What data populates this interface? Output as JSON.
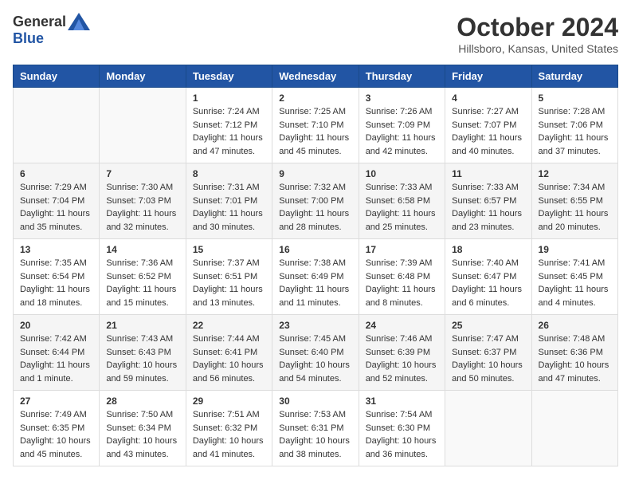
{
  "header": {
    "logo_general": "General",
    "logo_blue": "Blue",
    "month": "October 2024",
    "location": "Hillsboro, Kansas, United States"
  },
  "weekdays": [
    "Sunday",
    "Monday",
    "Tuesday",
    "Wednesday",
    "Thursday",
    "Friday",
    "Saturday"
  ],
  "weeks": [
    [
      {
        "day": "",
        "info": ""
      },
      {
        "day": "",
        "info": ""
      },
      {
        "day": "1",
        "info": "Sunrise: 7:24 AM\nSunset: 7:12 PM\nDaylight: 11 hours and 47 minutes."
      },
      {
        "day": "2",
        "info": "Sunrise: 7:25 AM\nSunset: 7:10 PM\nDaylight: 11 hours and 45 minutes."
      },
      {
        "day": "3",
        "info": "Sunrise: 7:26 AM\nSunset: 7:09 PM\nDaylight: 11 hours and 42 minutes."
      },
      {
        "day": "4",
        "info": "Sunrise: 7:27 AM\nSunset: 7:07 PM\nDaylight: 11 hours and 40 minutes."
      },
      {
        "day": "5",
        "info": "Sunrise: 7:28 AM\nSunset: 7:06 PM\nDaylight: 11 hours and 37 minutes."
      }
    ],
    [
      {
        "day": "6",
        "info": "Sunrise: 7:29 AM\nSunset: 7:04 PM\nDaylight: 11 hours and 35 minutes."
      },
      {
        "day": "7",
        "info": "Sunrise: 7:30 AM\nSunset: 7:03 PM\nDaylight: 11 hours and 32 minutes."
      },
      {
        "day": "8",
        "info": "Sunrise: 7:31 AM\nSunset: 7:01 PM\nDaylight: 11 hours and 30 minutes."
      },
      {
        "day": "9",
        "info": "Sunrise: 7:32 AM\nSunset: 7:00 PM\nDaylight: 11 hours and 28 minutes."
      },
      {
        "day": "10",
        "info": "Sunrise: 7:33 AM\nSunset: 6:58 PM\nDaylight: 11 hours and 25 minutes."
      },
      {
        "day": "11",
        "info": "Sunrise: 7:33 AM\nSunset: 6:57 PM\nDaylight: 11 hours and 23 minutes."
      },
      {
        "day": "12",
        "info": "Sunrise: 7:34 AM\nSunset: 6:55 PM\nDaylight: 11 hours and 20 minutes."
      }
    ],
    [
      {
        "day": "13",
        "info": "Sunrise: 7:35 AM\nSunset: 6:54 PM\nDaylight: 11 hours and 18 minutes."
      },
      {
        "day": "14",
        "info": "Sunrise: 7:36 AM\nSunset: 6:52 PM\nDaylight: 11 hours and 15 minutes."
      },
      {
        "day": "15",
        "info": "Sunrise: 7:37 AM\nSunset: 6:51 PM\nDaylight: 11 hours and 13 minutes."
      },
      {
        "day": "16",
        "info": "Sunrise: 7:38 AM\nSunset: 6:49 PM\nDaylight: 11 hours and 11 minutes."
      },
      {
        "day": "17",
        "info": "Sunrise: 7:39 AM\nSunset: 6:48 PM\nDaylight: 11 hours and 8 minutes."
      },
      {
        "day": "18",
        "info": "Sunrise: 7:40 AM\nSunset: 6:47 PM\nDaylight: 11 hours and 6 minutes."
      },
      {
        "day": "19",
        "info": "Sunrise: 7:41 AM\nSunset: 6:45 PM\nDaylight: 11 hours and 4 minutes."
      }
    ],
    [
      {
        "day": "20",
        "info": "Sunrise: 7:42 AM\nSunset: 6:44 PM\nDaylight: 11 hours and 1 minute."
      },
      {
        "day": "21",
        "info": "Sunrise: 7:43 AM\nSunset: 6:43 PM\nDaylight: 10 hours and 59 minutes."
      },
      {
        "day": "22",
        "info": "Sunrise: 7:44 AM\nSunset: 6:41 PM\nDaylight: 10 hours and 56 minutes."
      },
      {
        "day": "23",
        "info": "Sunrise: 7:45 AM\nSunset: 6:40 PM\nDaylight: 10 hours and 54 minutes."
      },
      {
        "day": "24",
        "info": "Sunrise: 7:46 AM\nSunset: 6:39 PM\nDaylight: 10 hours and 52 minutes."
      },
      {
        "day": "25",
        "info": "Sunrise: 7:47 AM\nSunset: 6:37 PM\nDaylight: 10 hours and 50 minutes."
      },
      {
        "day": "26",
        "info": "Sunrise: 7:48 AM\nSunset: 6:36 PM\nDaylight: 10 hours and 47 minutes."
      }
    ],
    [
      {
        "day": "27",
        "info": "Sunrise: 7:49 AM\nSunset: 6:35 PM\nDaylight: 10 hours and 45 minutes."
      },
      {
        "day": "28",
        "info": "Sunrise: 7:50 AM\nSunset: 6:34 PM\nDaylight: 10 hours and 43 minutes."
      },
      {
        "day": "29",
        "info": "Sunrise: 7:51 AM\nSunset: 6:32 PM\nDaylight: 10 hours and 41 minutes."
      },
      {
        "day": "30",
        "info": "Sunrise: 7:53 AM\nSunset: 6:31 PM\nDaylight: 10 hours and 38 minutes."
      },
      {
        "day": "31",
        "info": "Sunrise: 7:54 AM\nSunset: 6:30 PM\nDaylight: 10 hours and 36 minutes."
      },
      {
        "day": "",
        "info": ""
      },
      {
        "day": "",
        "info": ""
      }
    ]
  ]
}
